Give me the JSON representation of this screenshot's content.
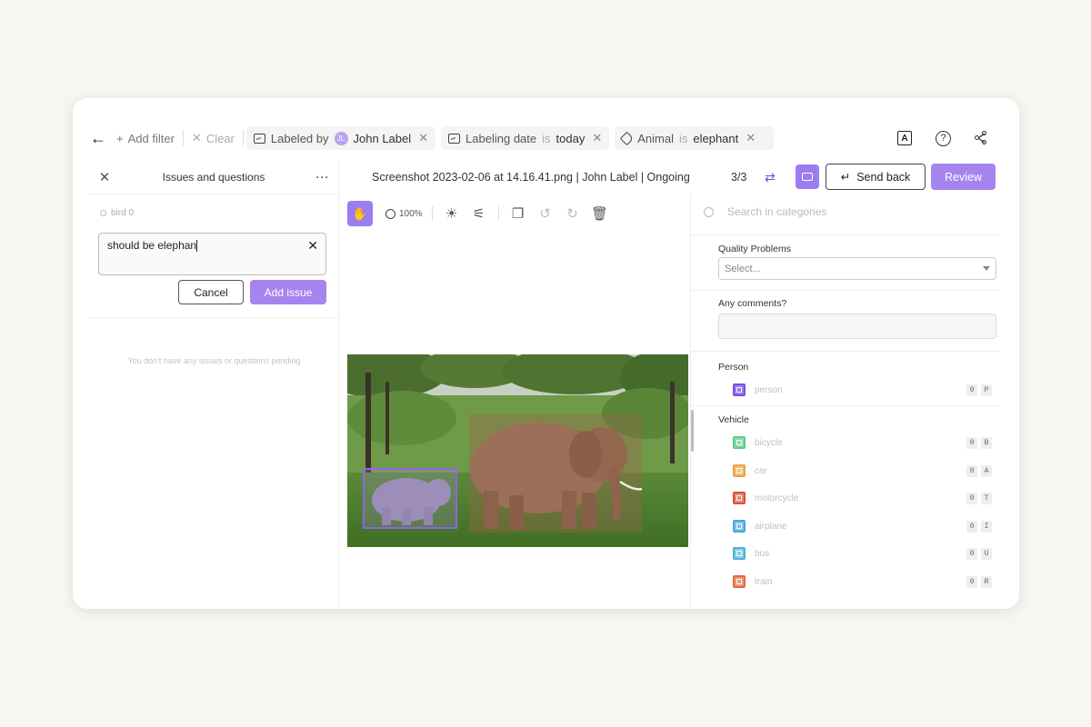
{
  "filterbar": {
    "add_filter": "Add filter",
    "clear": "Clear",
    "chips": [
      {
        "field": "Labeled by",
        "op": "",
        "value": "John Label",
        "avatar": "JL"
      },
      {
        "field": "Labeling date",
        "op": "is",
        "value": "today"
      },
      {
        "field": "Animal",
        "op": "is",
        "value": "elephant"
      }
    ]
  },
  "issues_panel": {
    "title": "Issues and questions",
    "object_label": "bird 0",
    "input_value": "should be elephan",
    "cancel_label": "Cancel",
    "add_label": "Add issue",
    "empty_text": "You don't have any issues or questions pending"
  },
  "header": {
    "file_info": "Screenshot 2023-02-06 at 14.16.41.png | John Label | Ongoing",
    "counter": "3/3",
    "send_back_label": "Send back",
    "review_label": "Review"
  },
  "toolbar": {
    "zoom": "100%"
  },
  "right_panel": {
    "search_placeholder": "Search in categories",
    "quality_label": "Quality Problems",
    "quality_select": "Select...",
    "comments_label": "Any comments?",
    "groups": [
      {
        "name": "Person",
        "items": [
          {
            "label": "person",
            "color": "#7c4ddc",
            "keys": [
              "0",
              "P"
            ]
          }
        ]
      },
      {
        "name": "Vehicle",
        "items": [
          {
            "label": "bicycle",
            "color": "#5cc98a",
            "keys": [
              "0",
              "B"
            ]
          },
          {
            "label": "car",
            "color": "#e8a24a",
            "keys": [
              "0",
              "A"
            ]
          },
          {
            "label": "motorcycle",
            "color": "#d9513c",
            "keys": [
              "0",
              "T"
            ]
          },
          {
            "label": "airplane",
            "color": "#4aa3dd",
            "keys": [
              "0",
              "I"
            ]
          },
          {
            "label": "bus",
            "color": "#4fb0d8",
            "keys": [
              "0",
              "U"
            ]
          },
          {
            "label": "train",
            "color": "#e06a3e",
            "keys": [
              "0",
              "R"
            ]
          }
        ]
      }
    ]
  },
  "colors": {
    "accent": "#a684ee",
    "accent_dark": "#9d7cf0"
  }
}
